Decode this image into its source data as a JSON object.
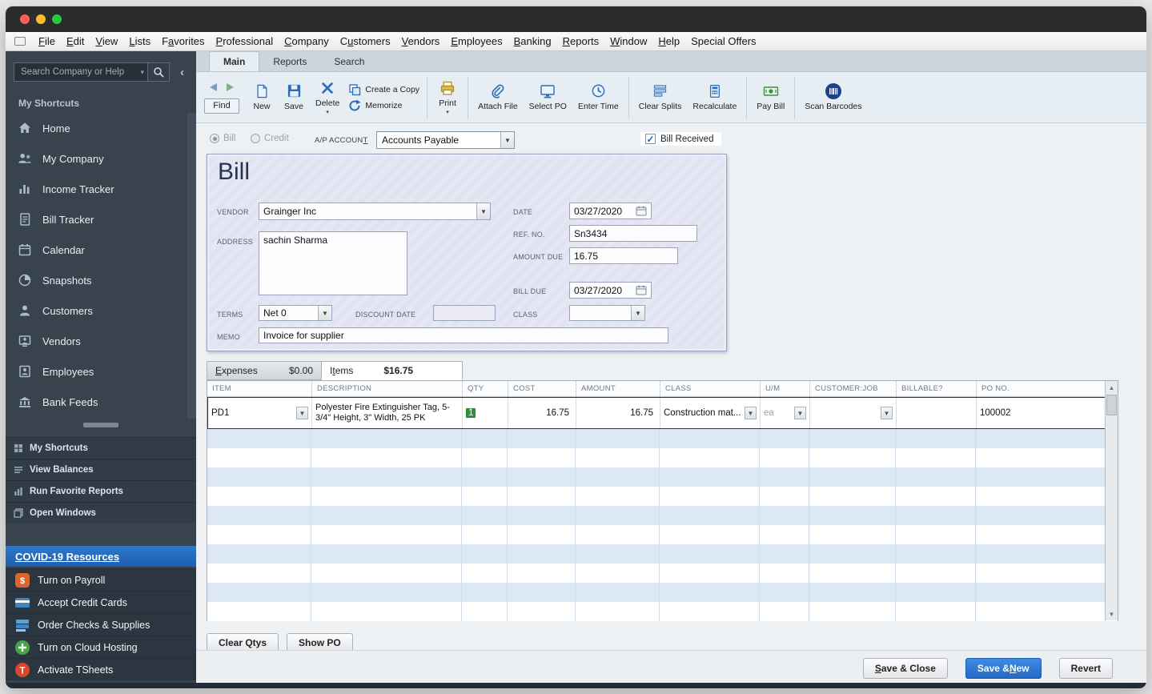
{
  "menubar": {
    "items": [
      {
        "label": "File"
      },
      {
        "label": "Edit"
      },
      {
        "label": "View"
      },
      {
        "label": "Lists"
      },
      {
        "label": "Favorites"
      },
      {
        "label": "Professional"
      },
      {
        "label": "Company"
      },
      {
        "label": "Customers"
      },
      {
        "label": "Vendors"
      },
      {
        "label": "Employees"
      },
      {
        "label": "Banking"
      },
      {
        "label": "Reports"
      },
      {
        "label": "Window"
      },
      {
        "label": "Help"
      },
      {
        "label": "Special Offers"
      }
    ]
  },
  "sidebar": {
    "search_placeholder": "Search Company or Help",
    "shortcuts_title": "My Shortcuts",
    "shortcuts": [
      {
        "label": "Home"
      },
      {
        "label": "My Company"
      },
      {
        "label": "Income Tracker"
      },
      {
        "label": "Bill Tracker"
      },
      {
        "label": "Calendar"
      },
      {
        "label": "Snapshots"
      },
      {
        "label": "Customers"
      },
      {
        "label": "Vendors"
      },
      {
        "label": "Employees"
      },
      {
        "label": "Bank Feeds"
      }
    ],
    "sections": [
      {
        "label": "My Shortcuts"
      },
      {
        "label": "View Balances"
      },
      {
        "label": "Run Favorite Reports"
      },
      {
        "label": "Open Windows"
      }
    ],
    "covid_link": "COVID-19 Resources",
    "promos": [
      {
        "label": "Turn on Payroll"
      },
      {
        "label": "Accept Credit Cards"
      },
      {
        "label": "Order Checks & Supplies"
      },
      {
        "label": "Turn on Cloud Hosting"
      },
      {
        "label": "Activate TSheets"
      }
    ]
  },
  "ribbon_tabs": {
    "main": "Main",
    "reports": "Reports",
    "search": "Search"
  },
  "toolbar": {
    "find": "Find",
    "new": "New",
    "save": "Save",
    "delete": "Delete",
    "create_copy": "Create a Copy",
    "memorize": "Memorize",
    "print": "Print",
    "attach_file": "Attach File",
    "select_po": "Select PO",
    "enter_time": "Enter Time",
    "clear_splits": "Clear Splits",
    "recalculate": "Recalculate",
    "pay_bill": "Pay Bill",
    "scan_barcodes": "Scan Barcodes"
  },
  "form": {
    "bill_radio": "Bill",
    "credit_radio": "Credit",
    "bill_selected": true,
    "ap_account_label": "A/P ACCOUNT",
    "ap_account_value": "Accounts Payable",
    "bill_received_label": "Bill Received",
    "bill_received_checked": true,
    "title": "Bill",
    "vendor_label": "VENDOR",
    "vendor_value": "Grainger Inc",
    "address_label": "ADDRESS",
    "address_value": "sachin Sharma",
    "date_label": "DATE",
    "date_value": "03/27/2020",
    "ref_label": "REF. NO.",
    "ref_value": "Sn3434",
    "amount_due_label": "AMOUNT DUE",
    "amount_due_value": "16.75",
    "bill_due_label": "BILL DUE",
    "bill_due_value": "03/27/2020",
    "terms_label": "TERMS",
    "terms_value": "Net 0",
    "discount_date_label": "DISCOUNT DATE",
    "discount_date_value": "",
    "class_label": "CLASS",
    "class_value": "",
    "memo_label": "MEMO",
    "memo_value": "Invoice for supplier"
  },
  "detail_tabs": {
    "expenses_label": "Expenses",
    "expenses_amount": "$0.00",
    "items_label": "Items",
    "items_amount": "$16.75"
  },
  "items_table": {
    "columns": [
      "ITEM",
      "DESCRIPTION",
      "QTY",
      "COST",
      "AMOUNT",
      "CLASS",
      "U/M",
      "CUSTOMER:JOB",
      "BILLABLE?",
      "PO NO."
    ],
    "rows": [
      {
        "item": "PD1",
        "description": "Polyester Fire Extinguisher Tag, 5-3/4\" Height, 3\" Width, 25 PK",
        "qty": "1",
        "cost": "16.75",
        "amount": "16.75",
        "class": "Construction mat...",
        "um": "ea",
        "customer_job": "",
        "billable": "",
        "po_no": "100002"
      }
    ],
    "empty_row_count": 10
  },
  "footer": {
    "clear_qtys": "Clear Qtys",
    "show_po": "Show PO",
    "save_close": "Save & Close",
    "save_new": "Save & New",
    "revert": "Revert"
  },
  "colors": {
    "primary_button": "#2e7bd0",
    "qty_highlight": "#2f8f3f",
    "sidebar_bg": "#39434d",
    "covid_bg": "#2a6fc0"
  }
}
